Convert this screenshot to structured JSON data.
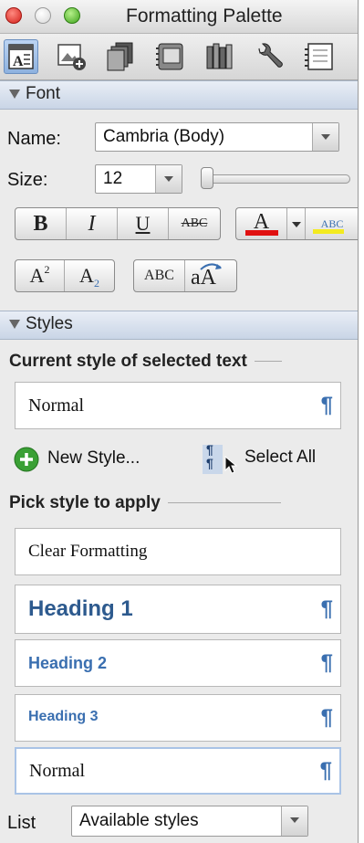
{
  "window": {
    "title": "Formatting Palette"
  },
  "toolbar": {
    "items": [
      {
        "name": "formatting-palette-tab-icon",
        "selected": true
      },
      {
        "name": "object-palette-tab-icon"
      },
      {
        "name": "toolbox-copy-icon"
      },
      {
        "name": "scrapbook-icon"
      },
      {
        "name": "reference-tools-icon"
      },
      {
        "name": "wrench-icon"
      },
      {
        "name": "notebook-icon"
      }
    ]
  },
  "font": {
    "section_label": "Font",
    "name_label": "Name:",
    "name_value": "Cambria (Body)",
    "size_label": "Size:",
    "size_value": "12",
    "bold": "B",
    "italic": "I",
    "underline": "U",
    "strikethrough": "ABC",
    "font_color_glyph": "A",
    "highlight_glyph": "ABC",
    "superscript_base": "A",
    "superscript_exp": "2",
    "subscript_base": "A",
    "subscript_exp": "2",
    "small_caps": "ABC",
    "change_case": "aA",
    "colors": {
      "font_color": "#e01010",
      "highlight": "#f3ea20"
    }
  },
  "styles": {
    "section_label": "Styles",
    "current_header": "Current style of selected text",
    "current_style": "Normal",
    "new_style_label": "New Style...",
    "select_all_label": "Select All",
    "pick_header": "Pick style to apply",
    "pick_list": [
      {
        "label": "Clear Formatting",
        "kind": "clear",
        "pilcrow": false
      },
      {
        "label": "Heading 1",
        "kind": "h1",
        "pilcrow": true
      },
      {
        "label": "Heading 2",
        "kind": "h2",
        "pilcrow": true
      },
      {
        "label": "Heading 3",
        "kind": "h3",
        "pilcrow": true
      },
      {
        "label": "Normal",
        "kind": "normal",
        "pilcrow": true,
        "selected": true
      }
    ],
    "pilcrow": "¶",
    "list_label": "List",
    "list_value": "Available styles",
    "accent_color": "#3a6fb0"
  }
}
